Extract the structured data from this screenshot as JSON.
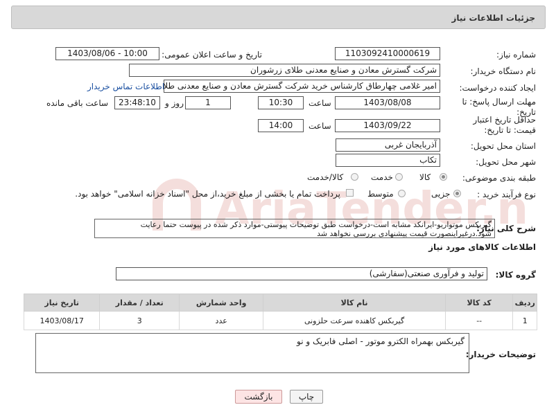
{
  "header": {
    "title": "جزئیات اطلاعات نیاز"
  },
  "fields": {
    "need_number": {
      "label": "شماره نیاز:",
      "value": "1103092410000619"
    },
    "public_date": {
      "label": "تاریخ و ساعت اعلان عمومی:",
      "value": "1403/08/06 - 10:00"
    },
    "buyer_org": {
      "label": "نام دستگاه خریدار:",
      "value": "شرکت گسترش معادن و صنایع معدنی طلای زرشوران"
    },
    "requester": {
      "label": "ایجاد کننده درخواست:",
      "value": "امیر غلامی چهارطاق کارشناس خرید شرکت گسترش معادن و صنایع معدنی طلای زرشوران",
      "link": "اطلاعات تماس خریدار"
    },
    "reply_deadline": {
      "label": "مهلت ارسال پاسخ: تا تاریخ:",
      "date": "1403/08/08",
      "time_label": "ساعت",
      "time": "10:30",
      "days": "1",
      "days_label": "روز و",
      "remaining": "23:48:10",
      "remaining_label": "ساعت باقی مانده"
    },
    "price_validity": {
      "label": "حداقل تاریخ اعتبار قیمت: تا تاریخ:",
      "date": "1403/09/22",
      "time_label": "ساعت",
      "time": "14:00"
    },
    "province": {
      "label": "استان محل تحویل:",
      "value": "آذربایجان غربی"
    },
    "city": {
      "label": "شهر محل تحویل:",
      "value": "تکاب"
    },
    "category": {
      "label": "طبقه بندی موضوعی:",
      "options": [
        "کالا",
        "خدمت",
        "کالا/خدمت"
      ]
    },
    "purchase_type": {
      "label": "نوع فرآیند خرید :",
      "options": [
        "جزیی",
        "متوسط"
      ],
      "note": "پرداخت تمام یا بخشی از مبلغ خرید،از محل \"اسناد خزانه اسلامی\" خواهد بود."
    }
  },
  "description": {
    "label": "شرح کلی نیاز:",
    "value": "گیربکس موتواریو-ایرانکد مشابه است-درخواست طبق توضیحات پیوستی-موارد ذکر شده در پیوست حتما رعایت شود.درغیراینصورت قیمت پیشنهادی بررسی نخواهد شد"
  },
  "goods_info": {
    "title": "اطلاعات کالاهای مورد نیاز",
    "group_label": "گروه کالا:",
    "group_value": "تولید و فرآوری صنعتی(سفارشی)"
  },
  "table": {
    "headers": [
      "ردیف",
      "کد کالا",
      "نام کالا",
      "واحد شمارش",
      "تعداد / مقدار",
      "تاریخ نیاز"
    ],
    "rows": [
      [
        "1",
        "--",
        "گیربکس کاهنده سرعت حلزونی",
        "عدد",
        "3",
        "1403/08/17"
      ]
    ]
  },
  "buyer_notes": {
    "label": "توضیحات خریدار:",
    "value": "گیربکس بهمراه الکترو موتور - اصلی فابریک و نو"
  },
  "buttons": {
    "print": "چاپ",
    "back": "بازگشت"
  },
  "watermark": {
    "text": "AriaTender.net"
  }
}
